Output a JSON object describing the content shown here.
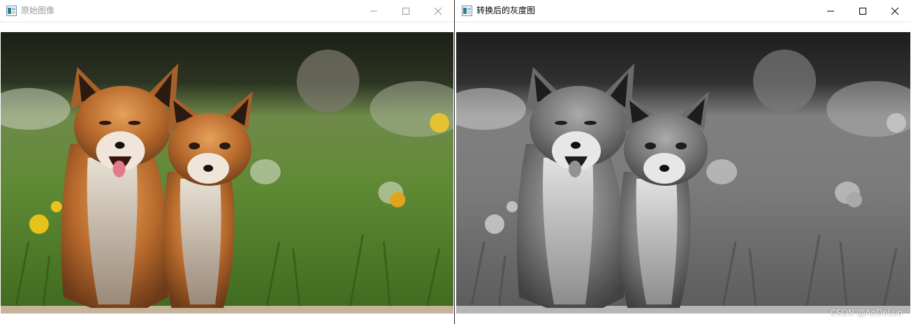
{
  "windows": [
    {
      "id": "left",
      "title": "原始图像",
      "title_state": "inactive",
      "image": "color fox photo"
    },
    {
      "id": "right",
      "title": "转换后的灰度图",
      "title_state": "active",
      "image": "grayscale fox photo"
    }
  ],
  "watermark": "CSDN @AoDeLuo",
  "icons": {
    "app": "app-window-icon",
    "minimize": "minimize-icon",
    "maximize": "maximize-icon",
    "close": "close-icon"
  },
  "colors": {
    "title_active": "#000000",
    "title_inactive": "#999999",
    "window_bg": "#ffffff"
  }
}
